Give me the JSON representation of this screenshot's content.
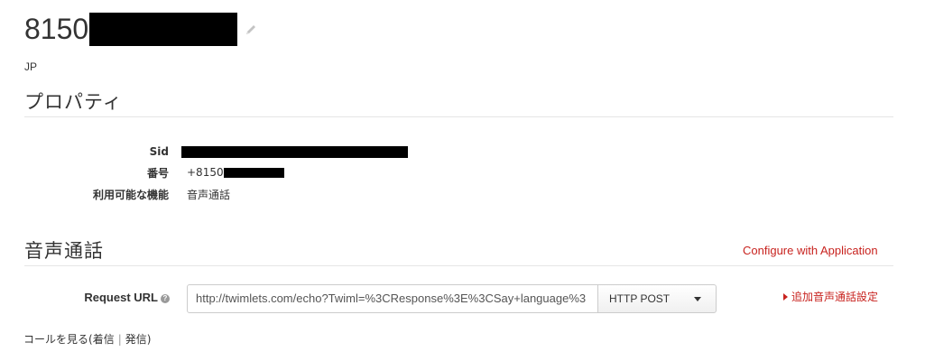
{
  "header": {
    "phone_prefix": "8150",
    "country": "JP"
  },
  "properties": {
    "title": "プロパティ",
    "rows": [
      {
        "label": "Sid"
      },
      {
        "label": "番号",
        "value_prefix": "+8150"
      },
      {
        "label": "利用可能な機能",
        "value": "音声通話"
      }
    ]
  },
  "voice": {
    "title": "音声通話",
    "configure_link": "Configure with Application",
    "request_url_label": "Request URL",
    "request_url_help": "?",
    "request_url_value": "http://twimlets.com/echo?Twiml=%3CResponse%3E%3CSay+language%3",
    "method_value": "HTTP POST",
    "add_setting_link": "追加音声通話設定"
  },
  "calls": {
    "prefix": "コールを見る(",
    "incoming": "着信",
    "separator": "|",
    "outgoing": "発信",
    "suffix": ")"
  },
  "icons": {
    "pencil": "pencil-icon",
    "help": "help-icon",
    "caret": "chevron-down-icon",
    "triangle": "triangle-right-icon"
  },
  "colors": {
    "accent_red": "#c8231f",
    "text": "#333333",
    "divider": "#e5e5e5"
  }
}
